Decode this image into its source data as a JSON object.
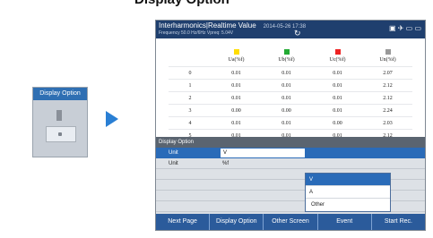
{
  "heading": "Display Option",
  "left_panel": {
    "title": "Display Option"
  },
  "screen": {
    "title": "Interharmonics|Realtime Value",
    "datetime": "2014-05-26 17:38",
    "subtitle": "Frequency   50.0 Hz/6Hz    Vpreq: 5.04V",
    "status_icons": "▣ ✈ ▭ ▭",
    "refresh_icon": "↻",
    "table": {
      "headers": [
        "",
        "Ua(%f)",
        "Ub(%f)",
        "Uc(%f)",
        "Un(%f)"
      ],
      "colors": [
        "#ffdd00",
        "#22aa33",
        "#ee2222",
        "#999999"
      ],
      "rows": [
        [
          "0",
          "0.01",
          "0.01",
          "0.01",
          "2.07"
        ],
        [
          "1",
          "0.01",
          "0.01",
          "0.01",
          "2.12"
        ],
        [
          "2",
          "0.01",
          "0.01",
          "0.01",
          "2.12"
        ],
        [
          "3",
          "0.00",
          "0.00",
          "0.01",
          "2.24"
        ],
        [
          "4",
          "0.01",
          "0.01",
          "0.00",
          "2.03"
        ],
        [
          "5",
          "0.01",
          "0.01",
          "0.01",
          "2.12"
        ]
      ]
    },
    "option_header": "Display Option",
    "option_rows": [
      {
        "label": "Unit",
        "value": "V"
      },
      {
        "label": "Unit",
        "value": "%f"
      }
    ],
    "dropdown": [
      "V",
      "A",
      "Other"
    ],
    "softkeys": [
      "Next Page",
      "Display Option",
      "Other Screen",
      "Event",
      "Start Rec."
    ]
  }
}
